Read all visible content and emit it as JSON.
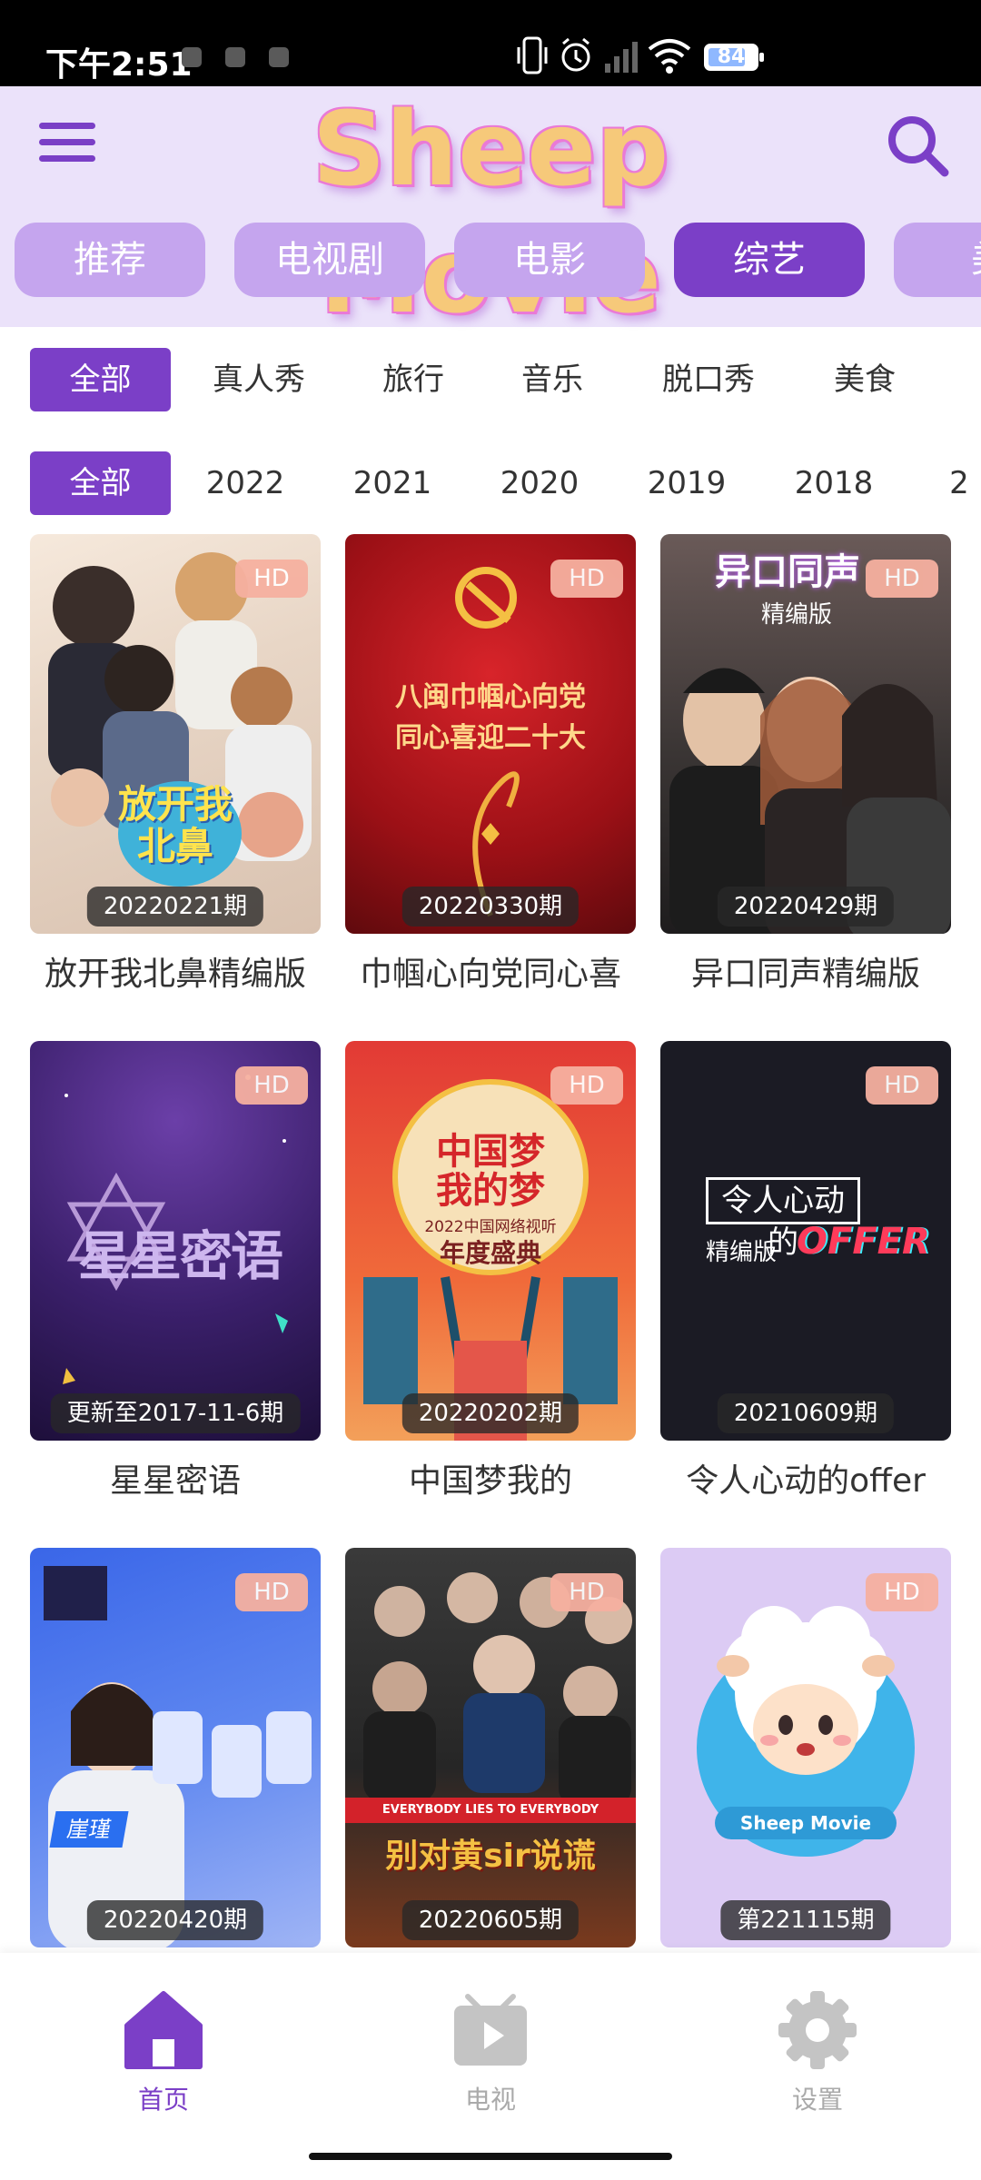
{
  "status_bar": {
    "time": "下午2:51",
    "battery": "84"
  },
  "header": {
    "logo": "Sheep Movie",
    "colors": {
      "accent": "#7b3fc7",
      "tab_inactive": "#c5a5ee",
      "header_bg": "#ebe2fa"
    }
  },
  "tabs": [
    {
      "label": "推荐",
      "active": false
    },
    {
      "label": "电视剧",
      "active": false
    },
    {
      "label": "电影",
      "active": false
    },
    {
      "label": "综艺",
      "active": true
    },
    {
      "label": "美",
      "active": false
    }
  ],
  "genre_filters": [
    "全部",
    "真人秀",
    "旅行",
    "音乐",
    "脱口秀",
    "美食"
  ],
  "year_filters": [
    "全部",
    "2022",
    "2021",
    "2020",
    "2019",
    "2018",
    "2"
  ],
  "cards": [
    {
      "title": "放开我北鼻精编版",
      "badge": "HD",
      "episode": "20220221期"
    },
    {
      "title": "巾帼心向党同心喜",
      "badge": "HD",
      "episode": "20220330期"
    },
    {
      "title": "异口同声精编版",
      "badge": "HD",
      "episode": "20220429期"
    },
    {
      "title": "星星密语",
      "badge": "HD",
      "episode": "更新至2017-11-6期"
    },
    {
      "title": "中国梦我的",
      "badge": "HD",
      "episode": "20220202期"
    },
    {
      "title": "令人心动的offer",
      "badge": "HD",
      "episode": "20210609期"
    },
    {
      "title": "",
      "badge": "HD",
      "episode": "20220420期"
    },
    {
      "title": "",
      "badge": "HD",
      "episode": "20220605期"
    },
    {
      "title": "",
      "badge": "HD",
      "episode": "第221115期"
    }
  ],
  "poster_texts": {
    "p1": "放开我北鼻",
    "p2a": "八闽巾帼心向党",
    "p2b": "同心喜迎二十大",
    "p3a": "异口同声",
    "p3b": "精编版",
    "p4": "星星密语",
    "p5a": "中国梦",
    "p5b": "我的梦",
    "p5c": "2022中国网络视听",
    "p5d": "年度盛典",
    "p6a": "令人心动的",
    "p6b": "精编版",
    "p6c": "OFFER",
    "p7": "崖瑾",
    "p8a": "EVERYBODY LIES TO EVERYBODY",
    "p8b": "别对黄sir说谎",
    "p9": "Sheep Movie"
  },
  "bottom_nav": [
    {
      "label": "首页",
      "icon": "home-icon",
      "active": true
    },
    {
      "label": "电视",
      "icon": "tv-icon",
      "active": false
    },
    {
      "label": "设置",
      "icon": "gear-icon",
      "active": false
    }
  ]
}
